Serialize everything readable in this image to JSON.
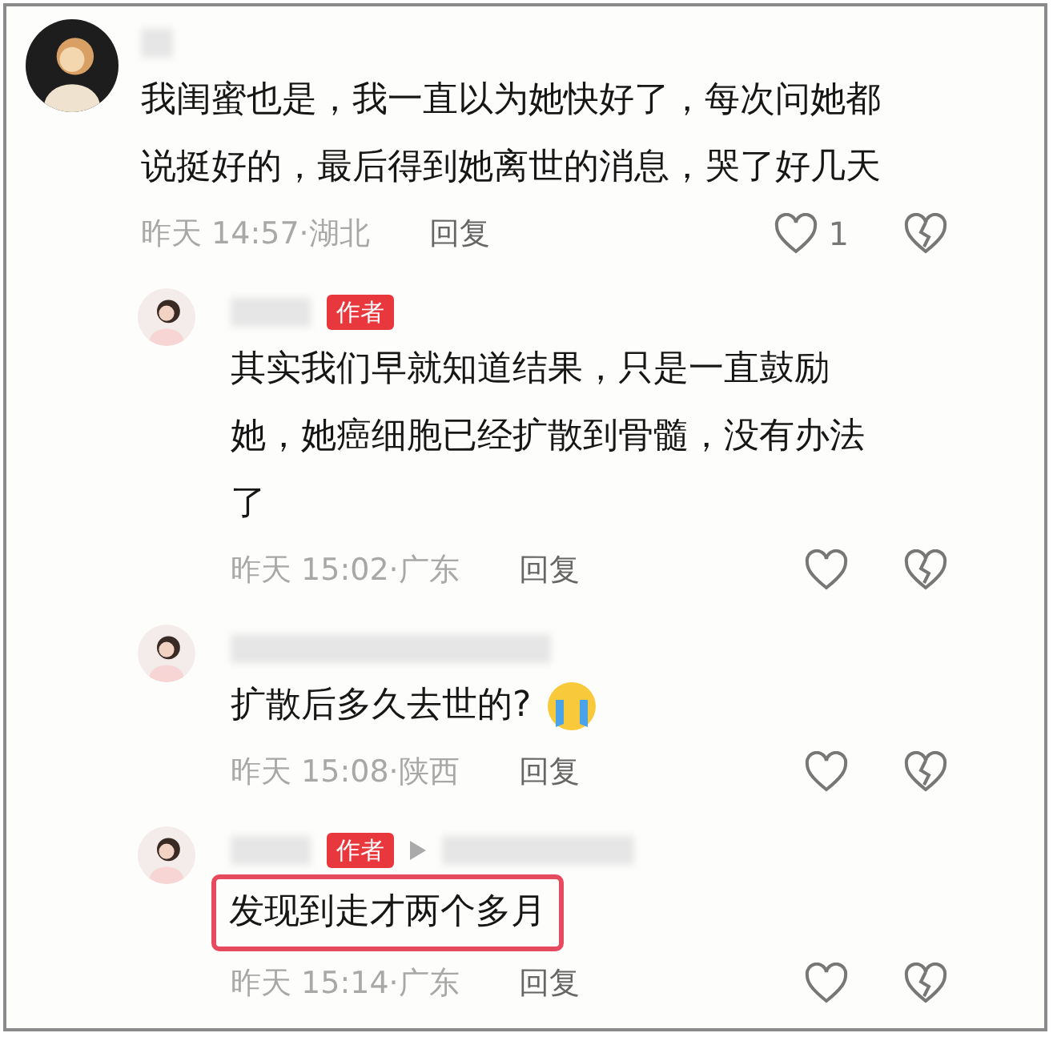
{
  "comments": [
    {
      "kind": "top",
      "has_reply_target": false,
      "highlighted": false,
      "text": "我闺蜜也是，我一直以为她快好了，每次问她都说挺好的，最后得到她离世的消息，哭了好几天",
      "emoji": false,
      "time": "昨天 14:57·湖北",
      "reply_label": "回复",
      "likes": "1"
    },
    {
      "kind": "reply",
      "badge": "作者",
      "has_reply_target": false,
      "highlighted": false,
      "text": "其实我们早就知道结果，只是一直鼓励她，她癌细胞已经扩散到骨髓，没有办法了",
      "emoji": false,
      "time": "昨天 15:02·广东",
      "reply_label": "回复"
    },
    {
      "kind": "reply",
      "has_reply_target": false,
      "highlighted": false,
      "text": "扩散后多久去世的?",
      "emoji": true,
      "time": "昨天 15:08·陕西",
      "reply_label": "回复"
    },
    {
      "kind": "reply",
      "badge": "作者",
      "has_reply_target": true,
      "highlighted": true,
      "text": "发现到走才两个多月",
      "emoji": false,
      "time": "昨天 15:14·广东",
      "reply_label": "回复"
    }
  ]
}
